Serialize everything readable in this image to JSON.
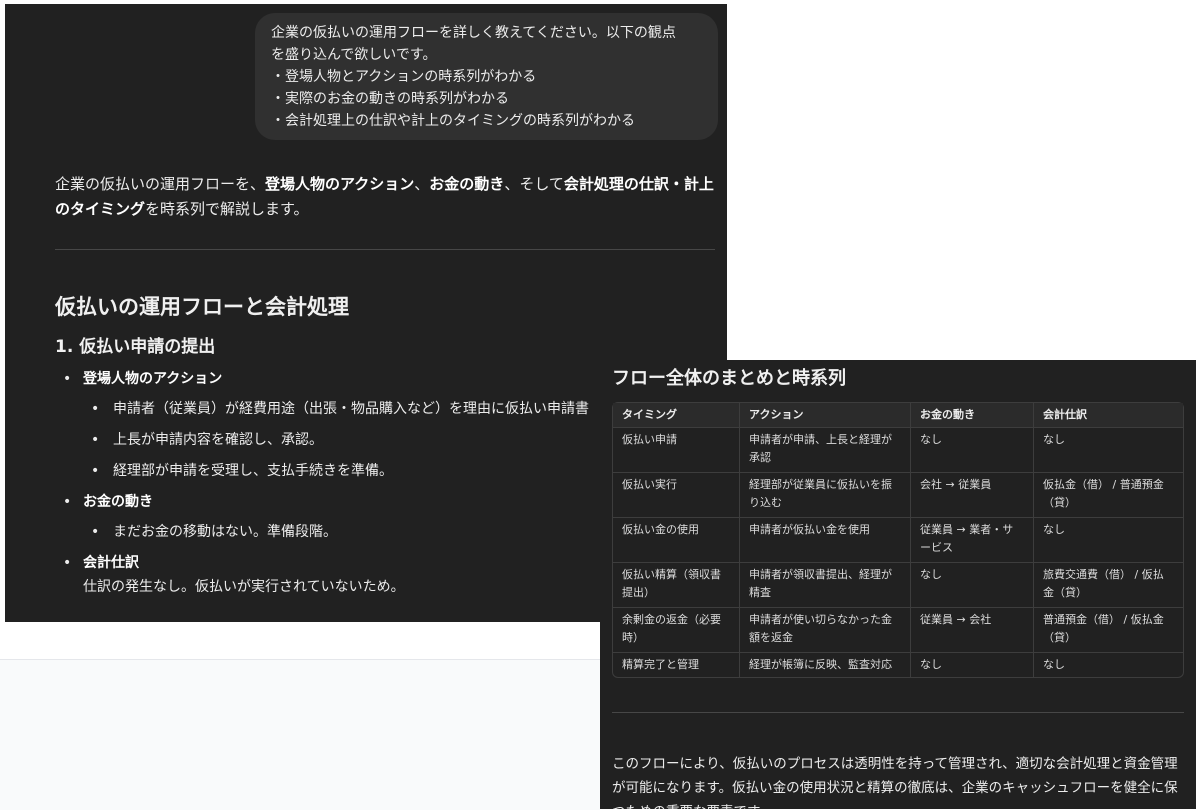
{
  "user_message": {
    "lines": [
      "企業の仮払いの運用フローを詳しく教えてください。以下の観点",
      "を盛り込んで欲しいです。",
      "・登場人物とアクションの時系列がわかる",
      "・実際のお金の動きの時系列がわかる",
      "・会計処理上の仕訳や計上のタイミングの時系列がわかる"
    ]
  },
  "response": {
    "intro": {
      "t1": "企業の仮払いの運用フローを、",
      "b1": "登場人物のアクション",
      "t2": "、",
      "b2": "お金の動き",
      "t3": "、そして",
      "b3": "会計処理の仕訳・計上のタイミング",
      "t4": "を時系列で解説します。"
    },
    "section_title": "仮払いの運用フローと会計処理",
    "step1": {
      "title": "1. 仮払い申請の提出",
      "actions_label": "登場人物のアクション",
      "actions": [
        "申請者（従業員）が経費用途（出張・物品購入など）を理由に仮払い申請書",
        "上長が申請内容を確認し、承認。",
        "経理部が申請を受理し、支払手続きを準備。"
      ],
      "money_label": "お金の動き",
      "money": [
        "まだお金の移動はない。準備段階。"
      ],
      "entry_label": "会計仕訳",
      "entry_text": "仕訳の発生なし。仮払いが実行されていないため。"
    }
  },
  "summary": {
    "title": "フロー全体のまとめと時系列",
    "headers": [
      "タイミング",
      "アクション",
      "お金の動き",
      "会計仕訳"
    ],
    "rows": [
      [
        "仮払い申請",
        "申請者が申請、上長と経理が承認",
        "なし",
        "なし"
      ],
      [
        "仮払い実行",
        "経理部が従業員に仮払いを振り込む",
        "会社 → 従業員",
        "仮払金（借） / 普通預金（貸）"
      ],
      [
        "仮払い金の使用",
        "申請者が仮払い金を使用",
        "従業員 → 業者・サービス",
        "なし"
      ],
      [
        "仮払い精算（領収書提出）",
        "申請者が領収書提出、経理が精査",
        "なし",
        "旅費交通費（借） / 仮払金（貸）"
      ],
      [
        "余剰金の返金（必要時）",
        "申請者が使い切らなかった金額を返金",
        "従業員 → 会社",
        "普通預金（借） / 仮払金（貸）"
      ],
      [
        "精算完了と管理",
        "経理が帳簿に反映、監査対応",
        "なし",
        "なし"
      ]
    ],
    "conclusion": "このフローにより、仮払いのプロセスは透明性を持って管理され、適切な会計処理と資金管理が可能になります。仮払い金の使用状況と精算の徹底は、企業のキャッシュフローを健全に保つための重要な要素です。"
  }
}
